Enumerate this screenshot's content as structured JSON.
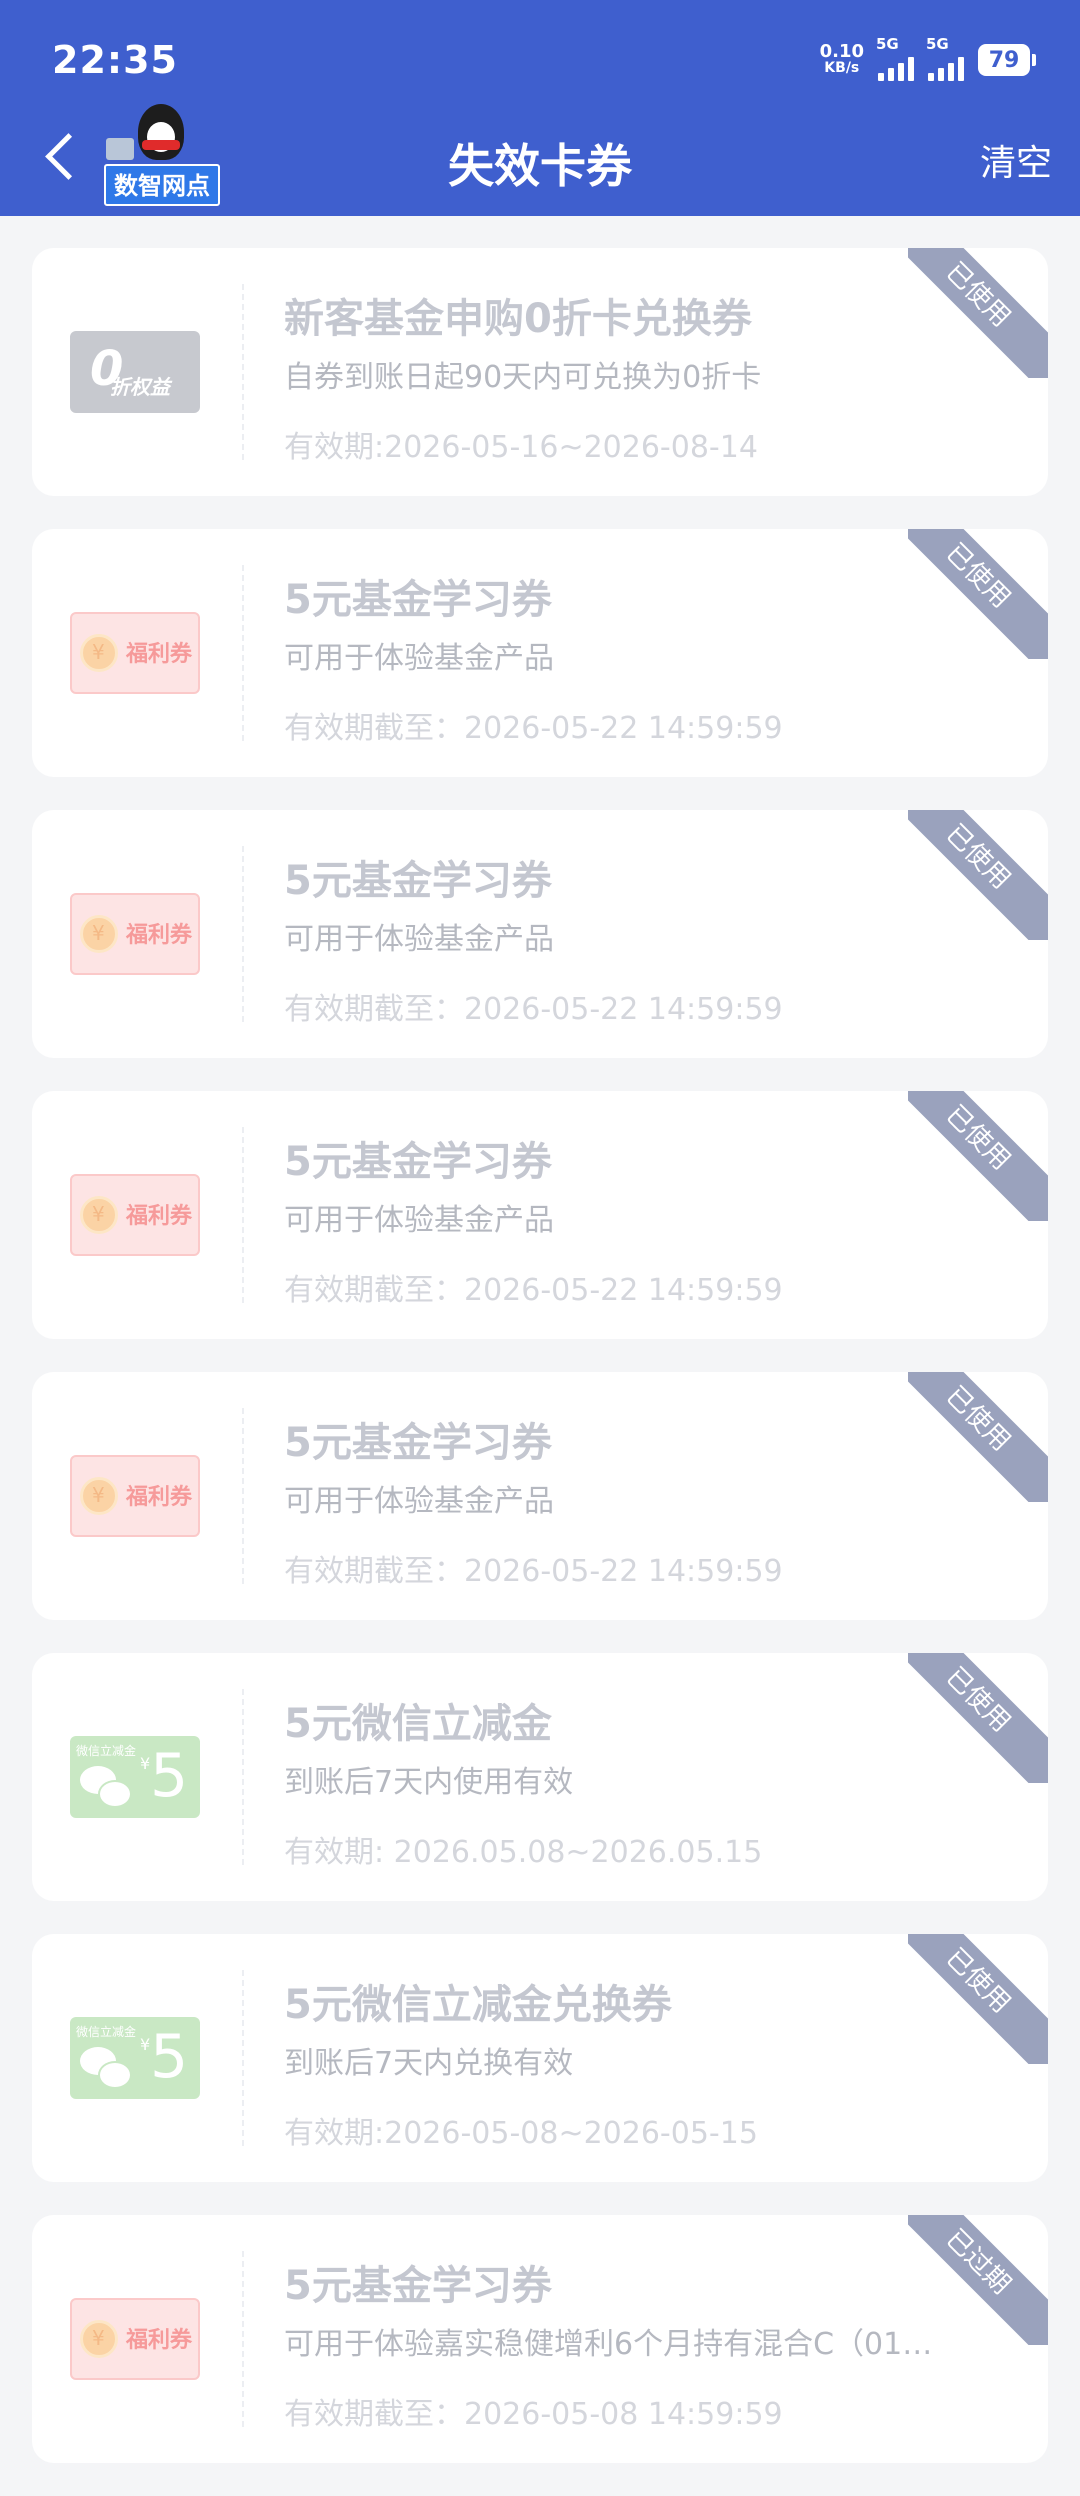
{
  "status_bar": {
    "time": "22:35",
    "net_speed": "0.10",
    "net_speed_unit": "KB/s",
    "sim1_label": "5G",
    "sim2_label": "5G",
    "battery": "79"
  },
  "header": {
    "title": "失效卡券",
    "clear_label": "清空",
    "logo_text": "数智网点"
  },
  "cards": [
    {
      "thumb": "zero",
      "thumb_big": "0",
      "thumb_text": "折权益",
      "title": "新客基金申购0折卡兑换券",
      "desc": "自券到账日起90天内可兑换为0折卡",
      "validity": "有效期:2026-05-16~2026-08-14",
      "status": "已使用"
    },
    {
      "thumb": "welfare",
      "thumb_text": "福利券",
      "title": "5元基金学习券",
      "desc": "可用于体验基金产品",
      "validity": "有效期截至：2026-05-22 14:59:59",
      "status": "已使用"
    },
    {
      "thumb": "welfare",
      "thumb_text": "福利券",
      "title": "5元基金学习券",
      "desc": "可用于体验基金产品",
      "validity": "有效期截至：2026-05-22 14:59:59",
      "status": "已使用"
    },
    {
      "thumb": "welfare",
      "thumb_text": "福利券",
      "title": "5元基金学习券",
      "desc": "可用于体验基金产品",
      "validity": "有效期截至：2026-05-22 14:59:59",
      "status": "已使用"
    },
    {
      "thumb": "welfare",
      "thumb_text": "福利券",
      "title": "5元基金学习券",
      "desc": "可用于体验基金产品",
      "validity": "有效期截至：2026-05-22 14:59:59",
      "status": "已使用"
    },
    {
      "thumb": "wechat",
      "thumb_title": "微信立减金",
      "thumb_value": "5",
      "title": "5元微信立减金",
      "desc": "到账后7天内使用有效",
      "validity": "有效期: 2026.05.08~2026.05.15",
      "status": "已使用"
    },
    {
      "thumb": "wechat",
      "thumb_title": "微信立减金",
      "thumb_value": "5",
      "title": "5元微信立减金兑换券",
      "desc": "到账后7天内兑换有效",
      "validity": "有效期:2026-05-08~2026-05-15",
      "status": "已使用"
    },
    {
      "thumb": "welfare",
      "thumb_text": "福利券",
      "title": "5元基金学习券",
      "desc": "可用于体验嘉实稳健增利6个月持有混合C（01…",
      "validity": "有效期截至：2026-05-08 14:59:59",
      "status": "已过期"
    }
  ]
}
